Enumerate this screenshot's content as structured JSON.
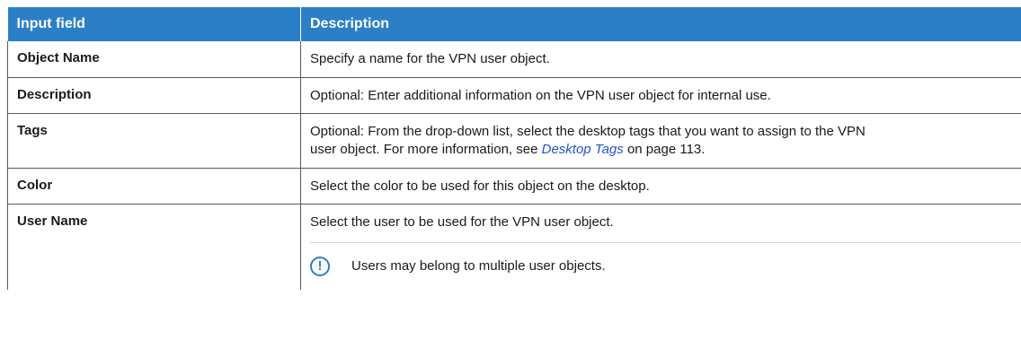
{
  "table": {
    "headers": [
      "Input field",
      "Description"
    ],
    "rows": [
      {
        "field": "Object Name",
        "description": "Specify a name for the VPN user object."
      },
      {
        "field": "Description",
        "description": "Optional: Enter additional information on the VPN user object for internal use."
      },
      {
        "field": "Tags",
        "description_line1": "Optional: From the drop-down list, select the desktop tags that you want to assign to the VPN",
        "description_line2_pre": "user object. For more information, see ",
        "link_text": "Desktop Tags",
        "description_line2_post": " on page 113."
      },
      {
        "field": "Color",
        "description": "Select the color to be used for this object on the desktop."
      },
      {
        "field": "User Name",
        "description": "Select the user to be used for the VPN user object.",
        "note": "Users may belong to multiple user objects.",
        "note_icon": "exclamation-circle-icon"
      }
    ]
  },
  "colors": {
    "header_bg": "#2b7fc6",
    "link": "#2255cc",
    "icon": "#2b7fc6"
  }
}
